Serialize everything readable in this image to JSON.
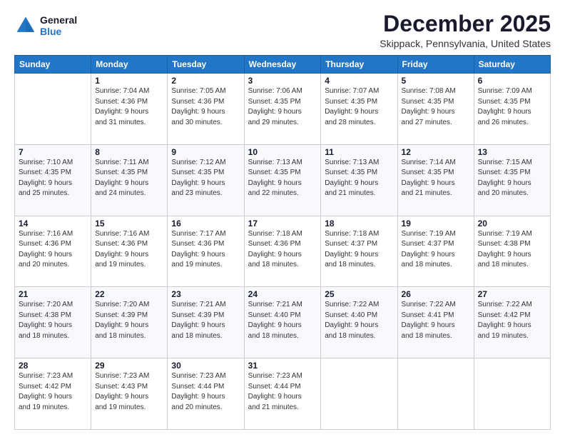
{
  "header": {
    "logo_line1": "General",
    "logo_line2": "Blue",
    "month": "December 2025",
    "location": "Skippack, Pennsylvania, United States"
  },
  "weekdays": [
    "Sunday",
    "Monday",
    "Tuesday",
    "Wednesday",
    "Thursday",
    "Friday",
    "Saturday"
  ],
  "weeks": [
    [
      {
        "day": "",
        "info": ""
      },
      {
        "day": "1",
        "info": "Sunrise: 7:04 AM\nSunset: 4:36 PM\nDaylight: 9 hours\nand 31 minutes."
      },
      {
        "day": "2",
        "info": "Sunrise: 7:05 AM\nSunset: 4:36 PM\nDaylight: 9 hours\nand 30 minutes."
      },
      {
        "day": "3",
        "info": "Sunrise: 7:06 AM\nSunset: 4:35 PM\nDaylight: 9 hours\nand 29 minutes."
      },
      {
        "day": "4",
        "info": "Sunrise: 7:07 AM\nSunset: 4:35 PM\nDaylight: 9 hours\nand 28 minutes."
      },
      {
        "day": "5",
        "info": "Sunrise: 7:08 AM\nSunset: 4:35 PM\nDaylight: 9 hours\nand 27 minutes."
      },
      {
        "day": "6",
        "info": "Sunrise: 7:09 AM\nSunset: 4:35 PM\nDaylight: 9 hours\nand 26 minutes."
      }
    ],
    [
      {
        "day": "7",
        "info": "Sunrise: 7:10 AM\nSunset: 4:35 PM\nDaylight: 9 hours\nand 25 minutes."
      },
      {
        "day": "8",
        "info": "Sunrise: 7:11 AM\nSunset: 4:35 PM\nDaylight: 9 hours\nand 24 minutes."
      },
      {
        "day": "9",
        "info": "Sunrise: 7:12 AM\nSunset: 4:35 PM\nDaylight: 9 hours\nand 23 minutes."
      },
      {
        "day": "10",
        "info": "Sunrise: 7:13 AM\nSunset: 4:35 PM\nDaylight: 9 hours\nand 22 minutes."
      },
      {
        "day": "11",
        "info": "Sunrise: 7:13 AM\nSunset: 4:35 PM\nDaylight: 9 hours\nand 21 minutes."
      },
      {
        "day": "12",
        "info": "Sunrise: 7:14 AM\nSunset: 4:35 PM\nDaylight: 9 hours\nand 21 minutes."
      },
      {
        "day": "13",
        "info": "Sunrise: 7:15 AM\nSunset: 4:35 PM\nDaylight: 9 hours\nand 20 minutes."
      }
    ],
    [
      {
        "day": "14",
        "info": "Sunrise: 7:16 AM\nSunset: 4:36 PM\nDaylight: 9 hours\nand 20 minutes."
      },
      {
        "day": "15",
        "info": "Sunrise: 7:16 AM\nSunset: 4:36 PM\nDaylight: 9 hours\nand 19 minutes."
      },
      {
        "day": "16",
        "info": "Sunrise: 7:17 AM\nSunset: 4:36 PM\nDaylight: 9 hours\nand 19 minutes."
      },
      {
        "day": "17",
        "info": "Sunrise: 7:18 AM\nSunset: 4:36 PM\nDaylight: 9 hours\nand 18 minutes."
      },
      {
        "day": "18",
        "info": "Sunrise: 7:18 AM\nSunset: 4:37 PM\nDaylight: 9 hours\nand 18 minutes."
      },
      {
        "day": "19",
        "info": "Sunrise: 7:19 AM\nSunset: 4:37 PM\nDaylight: 9 hours\nand 18 minutes."
      },
      {
        "day": "20",
        "info": "Sunrise: 7:19 AM\nSunset: 4:38 PM\nDaylight: 9 hours\nand 18 minutes."
      }
    ],
    [
      {
        "day": "21",
        "info": "Sunrise: 7:20 AM\nSunset: 4:38 PM\nDaylight: 9 hours\nand 18 minutes."
      },
      {
        "day": "22",
        "info": "Sunrise: 7:20 AM\nSunset: 4:39 PM\nDaylight: 9 hours\nand 18 minutes."
      },
      {
        "day": "23",
        "info": "Sunrise: 7:21 AM\nSunset: 4:39 PM\nDaylight: 9 hours\nand 18 minutes."
      },
      {
        "day": "24",
        "info": "Sunrise: 7:21 AM\nSunset: 4:40 PM\nDaylight: 9 hours\nand 18 minutes."
      },
      {
        "day": "25",
        "info": "Sunrise: 7:22 AM\nSunset: 4:40 PM\nDaylight: 9 hours\nand 18 minutes."
      },
      {
        "day": "26",
        "info": "Sunrise: 7:22 AM\nSunset: 4:41 PM\nDaylight: 9 hours\nand 18 minutes."
      },
      {
        "day": "27",
        "info": "Sunrise: 7:22 AM\nSunset: 4:42 PM\nDaylight: 9 hours\nand 19 minutes."
      }
    ],
    [
      {
        "day": "28",
        "info": "Sunrise: 7:23 AM\nSunset: 4:42 PM\nDaylight: 9 hours\nand 19 minutes."
      },
      {
        "day": "29",
        "info": "Sunrise: 7:23 AM\nSunset: 4:43 PM\nDaylight: 9 hours\nand 19 minutes."
      },
      {
        "day": "30",
        "info": "Sunrise: 7:23 AM\nSunset: 4:44 PM\nDaylight: 9 hours\nand 20 minutes."
      },
      {
        "day": "31",
        "info": "Sunrise: 7:23 AM\nSunset: 4:44 PM\nDaylight: 9 hours\nand 21 minutes."
      },
      {
        "day": "",
        "info": ""
      },
      {
        "day": "",
        "info": ""
      },
      {
        "day": "",
        "info": ""
      }
    ]
  ]
}
